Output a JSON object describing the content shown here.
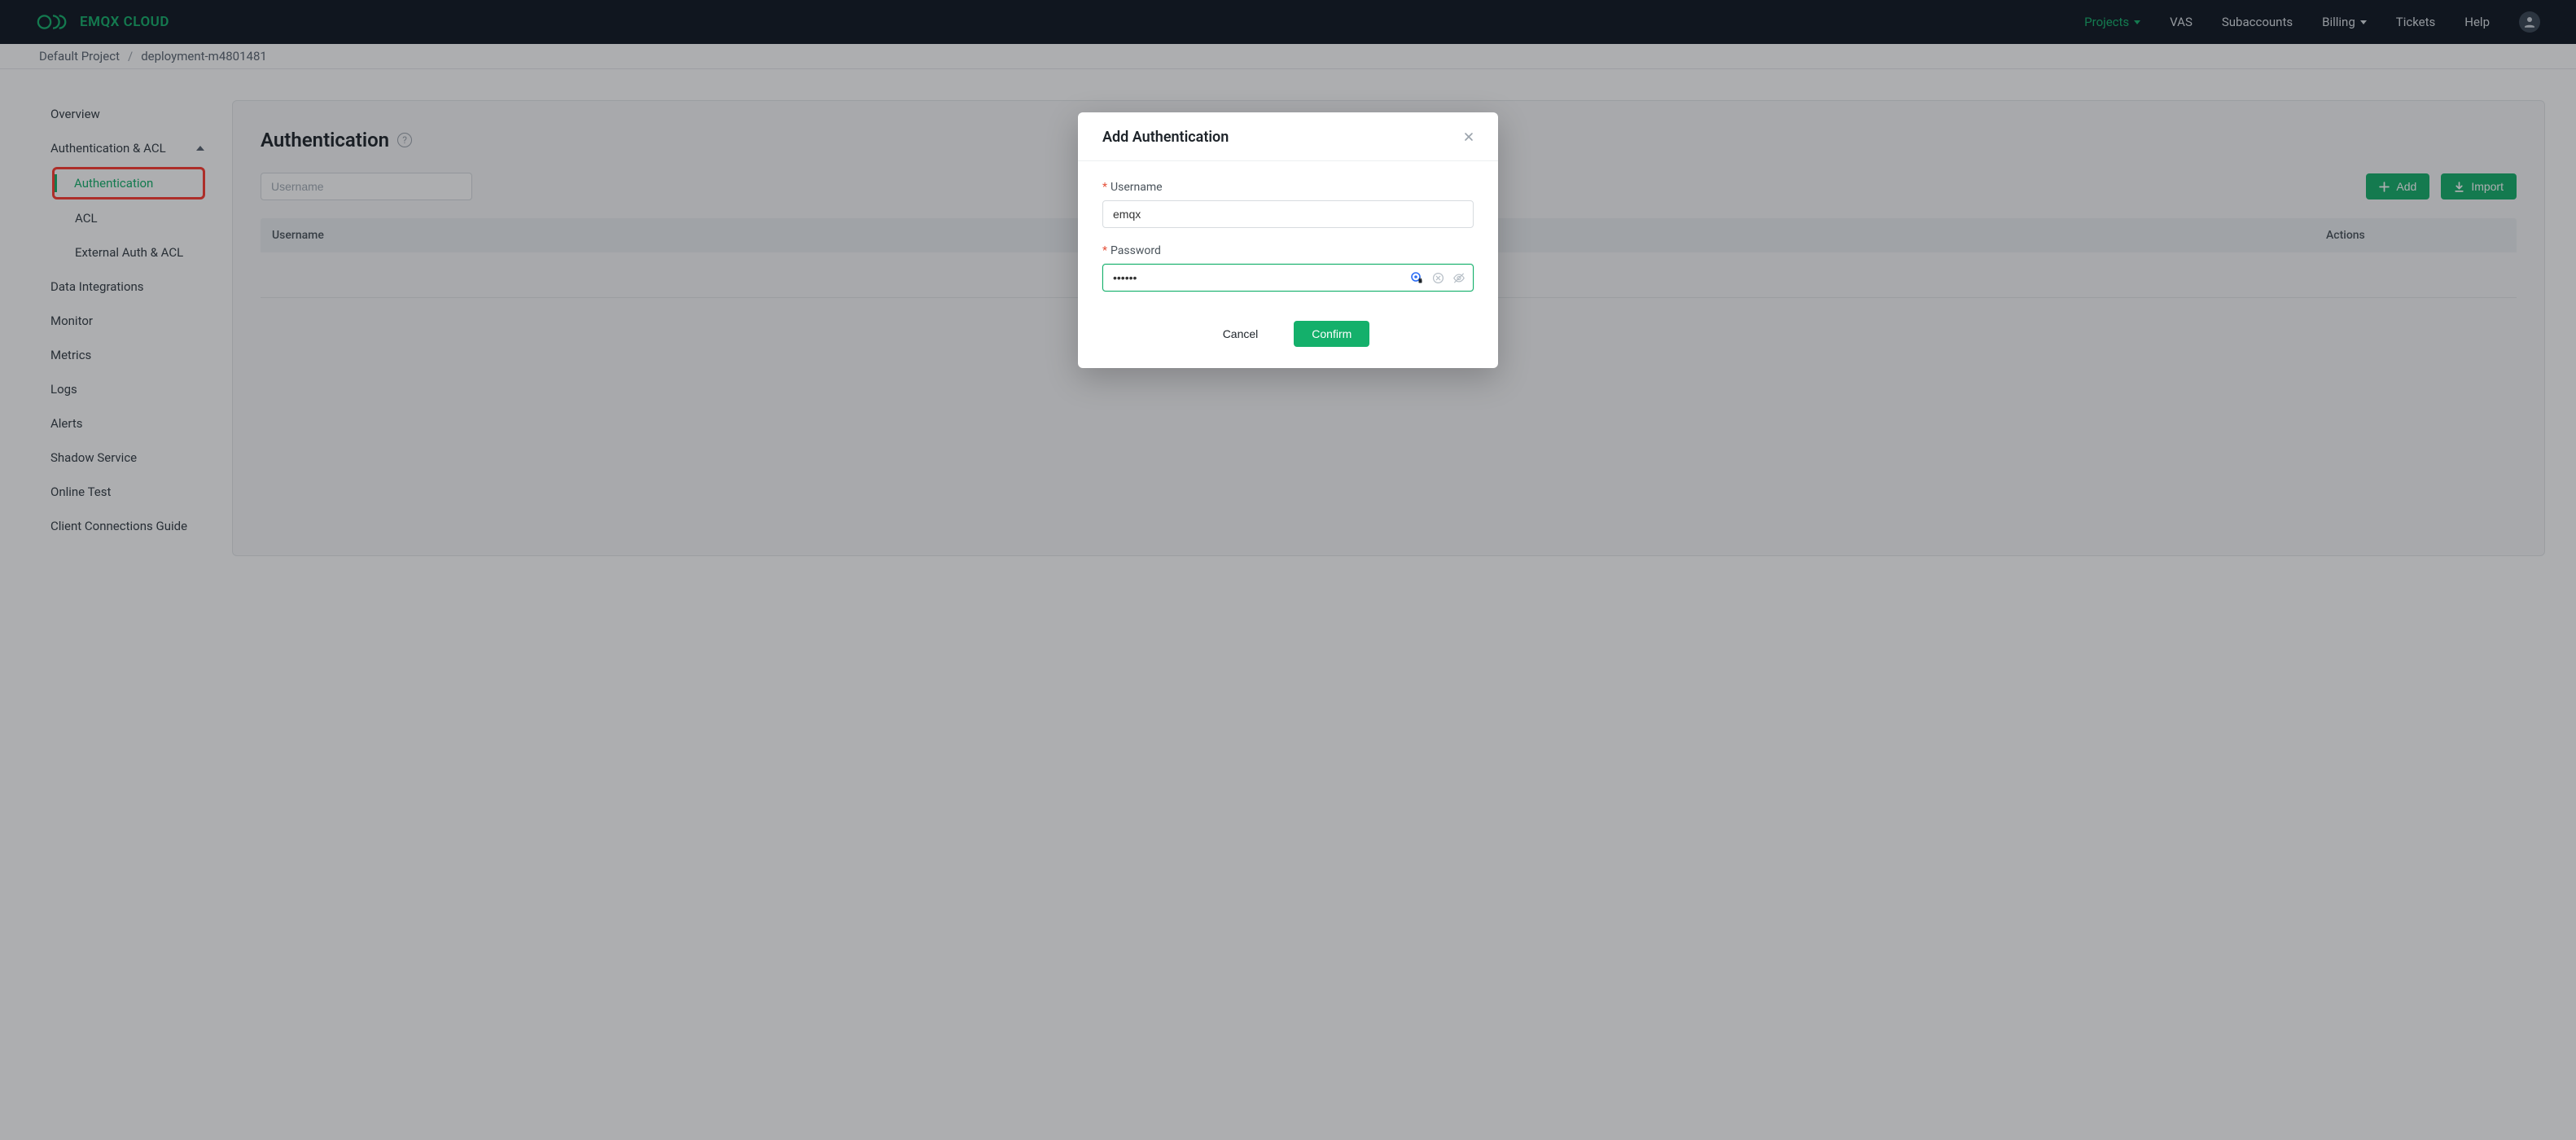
{
  "brand": {
    "name": "EMQX CLOUD"
  },
  "nav": {
    "projects": "Projects",
    "vas": "VAS",
    "subaccounts": "Subaccounts",
    "billing": "Billing",
    "tickets": "Tickets",
    "help": "Help"
  },
  "breadcrumb": {
    "root": "Default Project",
    "current": "deployment-m4801481"
  },
  "sidebar": {
    "overview": "Overview",
    "auth_acl": "Authentication & ACL",
    "auth": "Authentication",
    "acl": "ACL",
    "ext": "External Auth & ACL",
    "data_integrations": "Data Integrations",
    "monitor": "Monitor",
    "metrics": "Metrics",
    "logs": "Logs",
    "alerts": "Alerts",
    "shadow": "Shadow Service",
    "online_test": "Online Test",
    "ccg": "Client Connections Guide"
  },
  "panel": {
    "title": "Authentication",
    "search_placeholder": "Username",
    "add": "Add",
    "import": "Import",
    "col_username": "Username",
    "col_actions": "Actions"
  },
  "modal": {
    "title": "Add Authentication",
    "username_label": "Username",
    "username_value": "emqx",
    "password_label": "Password",
    "password_value": "••••••",
    "cancel": "Cancel",
    "confirm": "Confirm"
  }
}
